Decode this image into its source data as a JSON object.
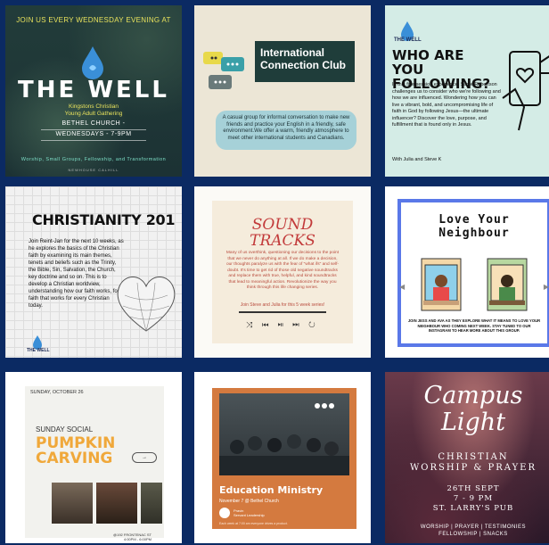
{
  "tiles": {
    "the_well": {
      "top": "JOIN US EVERY WEDNESDAY EVENING AT",
      "title": "THE WELL",
      "sub1": "Kingstons Christian",
      "sub2": "Young Adult Gathering",
      "line1": "BETHEL CHURCH -",
      "line2": "WEDNESDAYS - 7-9PM",
      "foot": "Worship, Small Groups, Fellowship, and Transformation",
      "foot2": "NEWHOUSE CALHILL"
    },
    "icc": {
      "title": "International Connection Club",
      "desc": "A casual group for informal conversation to make new friends and practice your English in a friendly, safe environment.We offer a warm, friendly atmosphere to meet other international students and Canadians."
    },
    "following": {
      "logo": "THE WELL",
      "title": "WHO ARE YOU FOLLOWING?",
      "body": "In this five-session experience, Sadie Robertson challenges us to consider who we're following and how we are influenced. Wondering how you can live a vibrant, bold, and uncompromising life of faith in God by following Jesus—the ultimate influencer? Discover the love, purpose, and fulfillment that is found only in Jesus.",
      "with": "With Julia and Steve K"
    },
    "christianity": {
      "title": "CHRISTIANITY 201",
      "body": "Join Reint-Jan for the next 10 weeks, as he explores the basics of the Christian faith by examining its main themes, tenets and beliefs such as the Trinity, the Bible, Sin, Salvation, the Church, key doctrine and so on. This is to develop a Christian worldview, understanding how our faith works, for a faith that works for every Christian today.",
      "logo": "THE WELL"
    },
    "soundtracks": {
      "title1": "SOUND",
      "title2": "TRACKS",
      "body": "Many of us overthink, questioning our decisions to the point that we never do anything at all. If we do make a decision, our thoughts paralyze us with the fear of \"what ifs\" and self-doubt. It's time to get rid of those old negative soundtracks and replace them with true, helpful, and kind soundtracks that lead to meaningful action. Revolutionize the way you think through this life changing series.",
      "join": "Join Steve and Julia for this 5 week series!",
      "controls": "⤨ ⏮ ⏯ ⏭ ↻"
    },
    "love": {
      "title1": "Love Your",
      "title2": "Neighbour",
      "desc": "JOIN JESS AND AVA AS THEY EXPLORE WHAT IT MEANS TO LOVE YOUR NEIGHBOUR WHO COMING NEXT WEEK. STAY TUNED TO OUR INSTAGRAM TO HEAR MORE ABOUT THIS GROUP."
    },
    "pumpkin": {
      "date": "SUNDAY, OCTOBER 26",
      "h1": "SUNDAY SOCIAL",
      "h2a": "PUMPKIN",
      "h2b": "CARVING",
      "arrow": "→",
      "addr1": "@192 FRONTENAC ST",
      "addr2": "4:00PM - 6:00PM"
    },
    "education": {
      "title": "Education Ministry",
      "sub": "November 7 @ Bethel Church",
      "av1": "Pravin",
      "av2": "Servant Leadership",
      "small": "Each week at 7:00 am everyone drives a product."
    },
    "campus": {
      "title1": "Campus",
      "title2": "Light",
      "sub1": "CHRISTIAN",
      "sub2": "WORSHIP & PRAYER",
      "when1": "26TH SEPT",
      "when2": "7 - 9 PM",
      "when3": "ST. LARRY'S PUB",
      "foot1": "WORSHIP | PRAYER | TESTIMONIES",
      "foot2": "FELLOWSHIP | SNACKS"
    }
  }
}
